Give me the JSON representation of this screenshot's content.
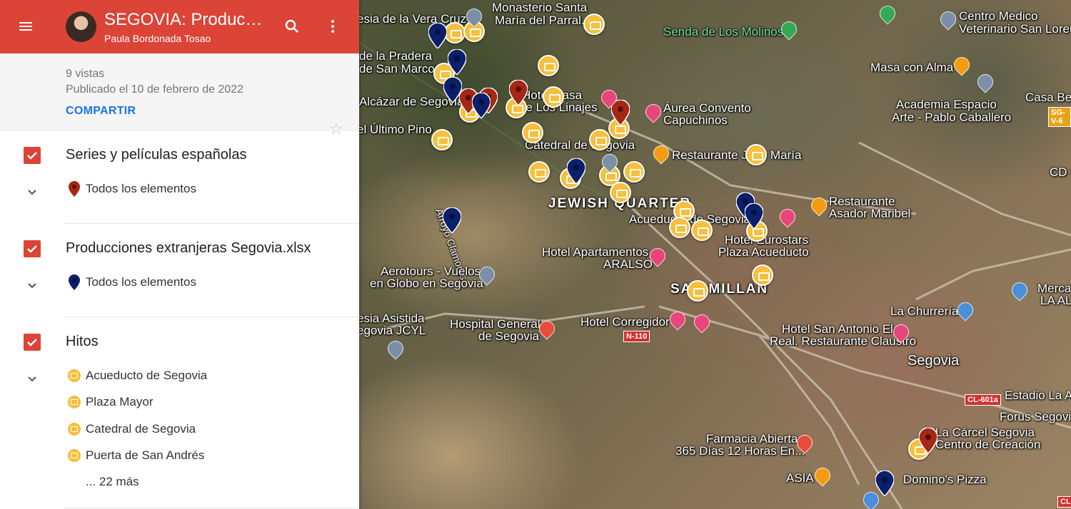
{
  "header": {
    "title": "SEGOVIA: Producciones audiovisuales",
    "author": "Paula Bordonada Tosao"
  },
  "info": {
    "views": "9 vistas",
    "published": "Publicado el 10 de febrero de 2022",
    "share_label": "COMPARTIR"
  },
  "layers": [
    {
      "title": "Series y películas españolas",
      "items": [
        "Todos los elementos"
      ],
      "color": "#a52714"
    },
    {
      "title": "Producciones extranjeras Segovia.xlsx",
      "items": [
        "Todos los elementos"
      ],
      "color": "#0b1f6b"
    },
    {
      "title": "Hitos",
      "items": [
        "Acueducto de Segovia",
        "Plaza Mayor",
        "Catedral de Segovia",
        "Puerta de San Andrés"
      ],
      "more": "... 22 más",
      "color": "#f6bf3d"
    }
  ],
  "map": {
    "labels": [
      "Monasterio Santa",
      "María del Parral...",
      "esia de la Vera Cruz",
      "Senda de Los Molinos",
      "Centro Medico",
      "Veterinario San Loren",
      "Masa con Alma",
      "Academia Espacio",
      "Arte - Pablo Caballero",
      "Casa Bel",
      "de la Pradera",
      "de San Marcos",
      "Alcázar de Segovia",
      "Hotel Casa",
      "de Los Linajes",
      "Áurea Convento",
      "Capuchinos",
      "el Último Pino",
      "Catedral de Segovia",
      "Restaurante José María",
      "CD S",
      "JEWISH QUARTER",
      "Restaurante",
      "Asador Maribel",
      "Acueducto de Segovia",
      "Hotel Eurostars",
      "Plaza Acueducto",
      "Hotel Apartamentos",
      "ARALSO",
      "Arroyo Clamores",
      "Aerotours - Vuelos",
      "en Globo en Segovia",
      "SAN MILLAN",
      "Mercado",
      "LA ALBU",
      "La Churrería",
      "esia Asistida",
      "egovia JCYL",
      "Hospital General",
      "de Segovia",
      "Hotel Corregidor",
      "Hotel San Antonio El",
      "Real. Restaurante Claustro",
      "Segovia",
      "Estadio La A",
      "Forus Segovia",
      "Farmacia Abierta",
      "365 Días 12 Horas En...",
      "La Cárcel Segovia",
      "Centro de Creación",
      "ASIA",
      "Domino's Pizza"
    ],
    "road_shields": [
      "N-110",
      "SG-V-6",
      "CL-601a",
      "CL-"
    ]
  }
}
